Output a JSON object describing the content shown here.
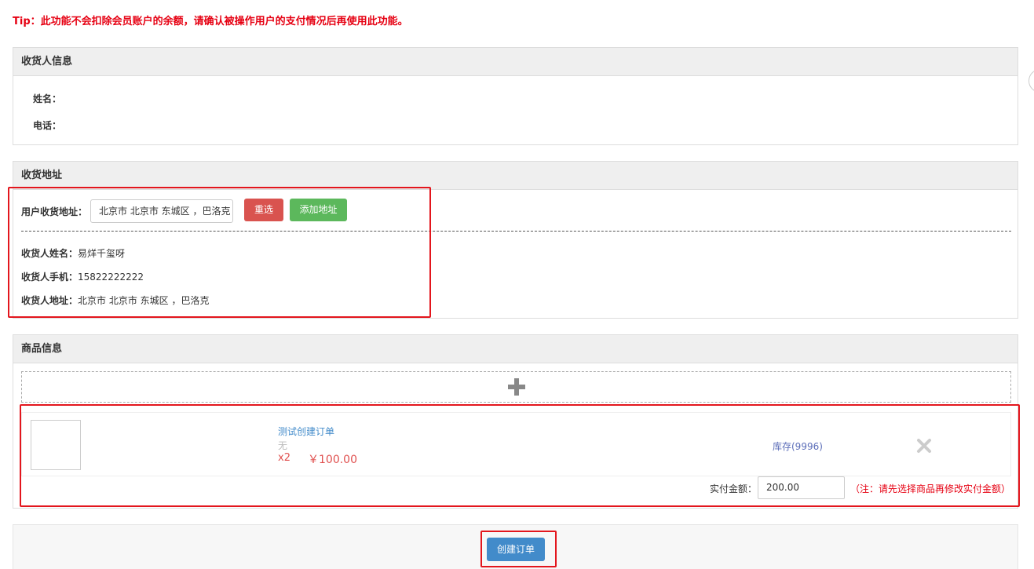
{
  "tip": "Tip：此功能不会扣除会员账户的余额，请确认被操作用户的支付情况后再使用此功能。",
  "receiver_info": {
    "title": "收货人信息",
    "name_label": "姓名：",
    "phone_label": "电话："
  },
  "address": {
    "title": "收货地址",
    "user_address_label": "用户收货地址：",
    "user_address_value": "北京市 北京市 东城区 ，巴洛克",
    "reselect_label": "重选",
    "add_address_label": "添加地址",
    "receiver_name_label": "收货人姓名：",
    "receiver_name_value": "易烊千玺呀",
    "receiver_phone_label": "收货人手机：",
    "receiver_phone_value": "15822222222",
    "receiver_address_label": "收货人地址：",
    "receiver_address_value": "北京市 北京市 东城区 ，巴洛克"
  },
  "goods": {
    "title": "商品信息",
    "add_icon": "plus-icon",
    "item": {
      "name": "测试创建订单",
      "spec": "无",
      "qty": "x2",
      "price": "￥100.00",
      "stock": "库存(9996)",
      "remove_icon": "close-icon"
    },
    "paid_label": "实付金额：",
    "paid_value": "200.00",
    "paid_note": "（注：请先选择商品再修改实付金额）"
  },
  "submit_label": "创建订单",
  "colors": {
    "tip": "#e60012",
    "danger_button": "#d9534f",
    "success_button": "#5cb85c",
    "primary_button": "#428bca",
    "link": "#428bca",
    "highlight_box": "#e3161d"
  }
}
